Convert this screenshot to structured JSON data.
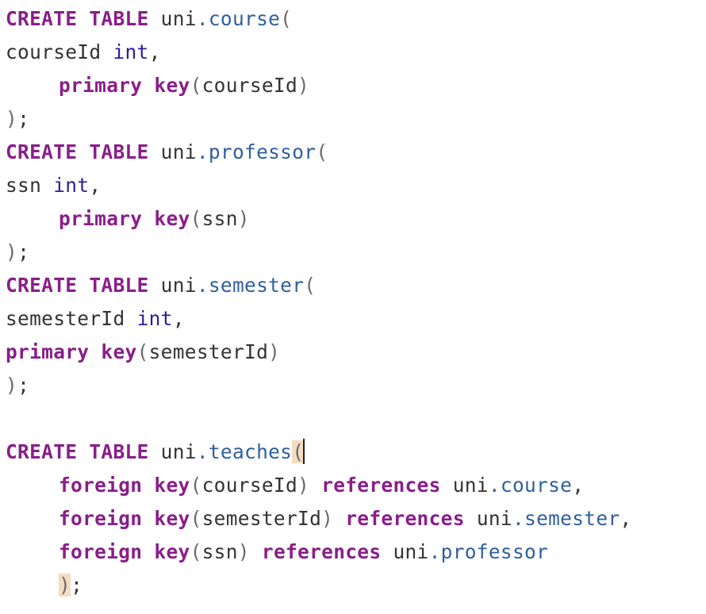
{
  "editor": {
    "lines": [
      [
        {
          "t": "CREATE TABLE",
          "c": "kw"
        },
        {
          "t": " uni",
          "c": "plain"
        },
        {
          "t": ".course",
          "c": "prop"
        },
        {
          "t": "(",
          "c": "punc"
        }
      ],
      [
        {
          "t": "courseId ",
          "c": "plain"
        },
        {
          "t": "int",
          "c": "ty"
        },
        {
          "t": ",",
          "c": "plain"
        }
      ],
      [
        {
          "t": "    ",
          "c": "ind"
        },
        {
          "t": "primary key",
          "c": "kw"
        },
        {
          "t": "(",
          "c": "punc"
        },
        {
          "t": "courseId",
          "c": "plain"
        },
        {
          "t": ")",
          "c": "punc"
        }
      ],
      [
        {
          "t": ")",
          "c": "punc"
        },
        {
          "t": ";",
          "c": "plain"
        }
      ],
      [
        {
          "t": "CREATE TABLE",
          "c": "kw"
        },
        {
          "t": " uni",
          "c": "plain"
        },
        {
          "t": ".professor",
          "c": "prop"
        },
        {
          "t": "(",
          "c": "punc"
        }
      ],
      [
        {
          "t": "ssn ",
          "c": "plain"
        },
        {
          "t": "int",
          "c": "ty"
        },
        {
          "t": ",",
          "c": "plain"
        }
      ],
      [
        {
          "t": "    ",
          "c": "ind"
        },
        {
          "t": "primary key",
          "c": "kw"
        },
        {
          "t": "(",
          "c": "punc"
        },
        {
          "t": "ssn",
          "c": "plain"
        },
        {
          "t": ")",
          "c": "punc"
        }
      ],
      [
        {
          "t": ")",
          "c": "punc"
        },
        {
          "t": ";",
          "c": "plain"
        }
      ],
      [
        {
          "t": "CREATE TABLE",
          "c": "kw"
        },
        {
          "t": " uni",
          "c": "plain"
        },
        {
          "t": ".semester",
          "c": "prop"
        },
        {
          "t": "(",
          "c": "punc"
        }
      ],
      [
        {
          "t": "semesterId ",
          "c": "plain"
        },
        {
          "t": "int",
          "c": "ty"
        },
        {
          "t": ",",
          "c": "plain"
        }
      ],
      [
        {
          "t": "primary key",
          "c": "kw"
        },
        {
          "t": "(",
          "c": "punc"
        },
        {
          "t": "semesterId",
          "c": "plain"
        },
        {
          "t": ")",
          "c": "punc"
        }
      ],
      [
        {
          "t": ")",
          "c": "punc"
        },
        {
          "t": ";",
          "c": "plain"
        }
      ],
      [],
      [
        {
          "t": "CREATE TABLE",
          "c": "kw"
        },
        {
          "t": " uni",
          "c": "plain"
        },
        {
          "t": ".teaches",
          "c": "prop"
        },
        {
          "t": "(",
          "c": "punc match"
        },
        {
          "t": "",
          "c": "cursor"
        }
      ],
      [
        {
          "t": "    ",
          "c": "ind"
        },
        {
          "t": "foreign key",
          "c": "kw"
        },
        {
          "t": "(",
          "c": "punc"
        },
        {
          "t": "courseId",
          "c": "plain"
        },
        {
          "t": ") ",
          "c": "punc"
        },
        {
          "t": "references",
          "c": "kw"
        },
        {
          "t": " uni",
          "c": "plain"
        },
        {
          "t": ".course",
          "c": "prop"
        },
        {
          "t": ",",
          "c": "plain"
        }
      ],
      [
        {
          "t": "    ",
          "c": "ind"
        },
        {
          "t": "foreign key",
          "c": "kw"
        },
        {
          "t": "(",
          "c": "punc"
        },
        {
          "t": "semesterId",
          "c": "plain"
        },
        {
          "t": ") ",
          "c": "punc"
        },
        {
          "t": "references",
          "c": "kw"
        },
        {
          "t": " uni",
          "c": "plain"
        },
        {
          "t": ".semester",
          "c": "prop"
        },
        {
          "t": ",",
          "c": "plain"
        }
      ],
      [
        {
          "t": "    ",
          "c": "ind"
        },
        {
          "t": "foreign key",
          "c": "kw"
        },
        {
          "t": "(",
          "c": "punc"
        },
        {
          "t": "ssn",
          "c": "plain"
        },
        {
          "t": ") ",
          "c": "punc"
        },
        {
          "t": "references",
          "c": "kw"
        },
        {
          "t": " uni",
          "c": "plain"
        },
        {
          "t": ".professor",
          "c": "prop"
        }
      ],
      [
        {
          "t": "    ",
          "c": "ind"
        },
        {
          "t": ")",
          "c": "punc match"
        },
        {
          "t": ";",
          "c": "plain"
        }
      ]
    ]
  }
}
